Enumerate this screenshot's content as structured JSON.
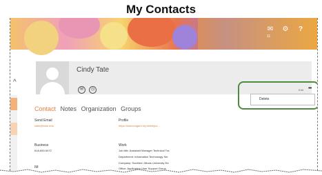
{
  "caption": "My Contacts",
  "ribbon": {
    "icons": [
      "mail-icon",
      "gear-icon",
      "help-icon"
    ],
    "mail_count": "11",
    "help_label": "?"
  },
  "contact": {
    "name": "Cindy Tate",
    "edit_label": "Edit",
    "more_label": "•••",
    "menu_item": "Delete"
  },
  "tabs": [
    {
      "label": "Contact",
      "active": true
    },
    {
      "label": "Notes",
      "active": false
    },
    {
      "label": "Organization",
      "active": false
    },
    {
      "label": "Groups",
      "active": false
    }
  ],
  "fields": {
    "send_email_label": "Send Email",
    "send_email_value": "ctate@siue.edu",
    "profile_label": "Profile",
    "profile_value": "https://siuecougars-my.sharepoi...",
    "business_label": "Business",
    "business_value": "618-650-5472",
    "work_label": "Work",
    "job_title": "Job title:  Assistant Manager Technical Tra",
    "department": "Department:  Information Technology Ser",
    "company": "Company:  Southern Illinois University Ed",
    "office": "Office:  Application User Support Group",
    "im_label": "IM"
  }
}
